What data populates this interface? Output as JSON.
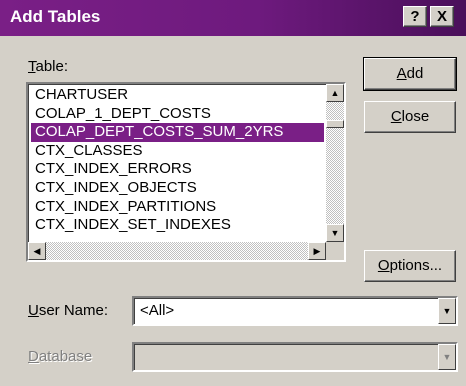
{
  "window": {
    "title": "Add Tables",
    "help_label": "?",
    "close_label": "X"
  },
  "table_label_mnemonic": "T",
  "table_label_rest": "able:",
  "tables": [
    "CHARTUSER",
    "COLAP_1_DEPT_COSTS",
    "COLAP_DEPT_COSTS_SUM_2YRS",
    "CTX_CLASSES",
    "CTX_INDEX_ERRORS",
    "CTX_INDEX_OBJECTS",
    "CTX_INDEX_PARTITIONS",
    "CTX_INDEX_SET_INDEXES"
  ],
  "selected_table": "COLAP_DEPT_COSTS_SUM_2YRS",
  "buttons": {
    "add_mnemonic": "A",
    "add_rest": "dd",
    "close_mnemonic": "C",
    "close_rest": "lose",
    "options_mnemonic": "O",
    "options_rest": "ptions..."
  },
  "user_name": {
    "label_mnemonic": "U",
    "label_rest": "ser Name:",
    "value": "<All>"
  },
  "database": {
    "label_mnemonic": "D",
    "label_rest": "atabase",
    "value": ""
  },
  "colors": {
    "titlebar": "#7a1f86",
    "selection": "#7a1f86",
    "face": "#d4d0c8"
  }
}
